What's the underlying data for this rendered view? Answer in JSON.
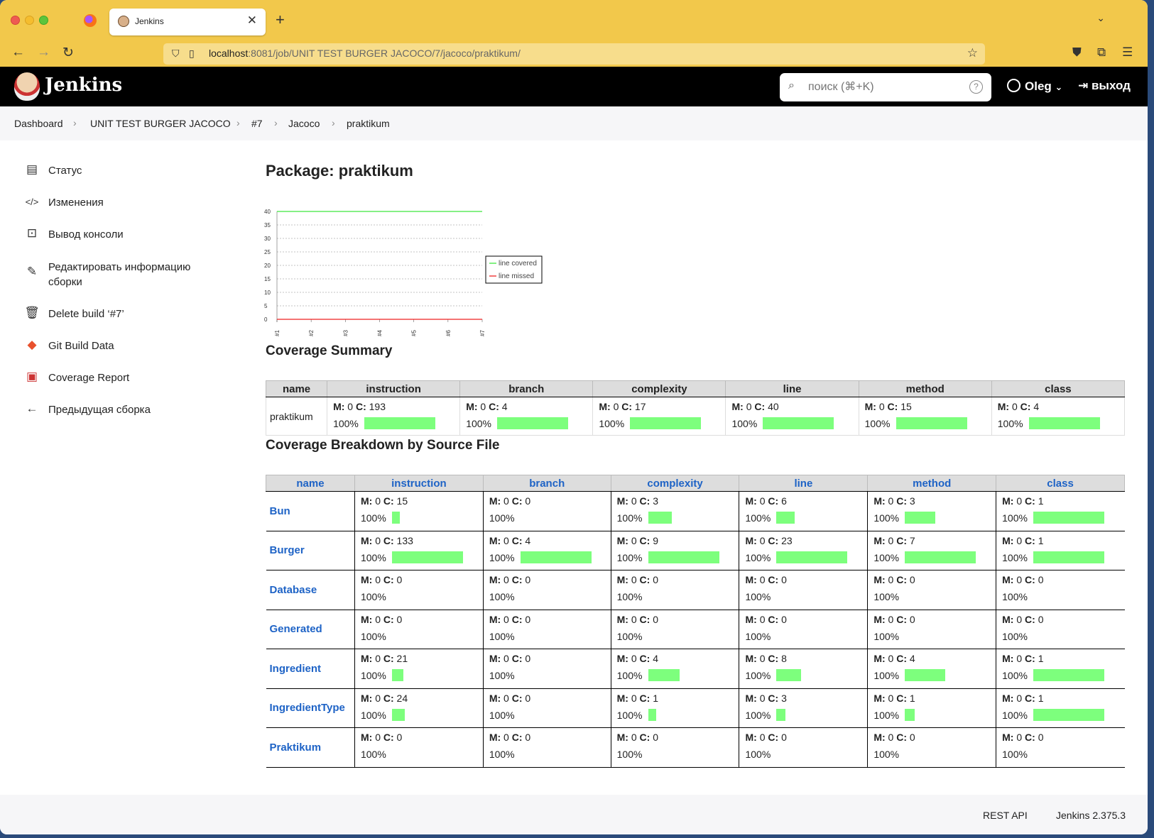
{
  "browser": {
    "tab_title": "Jenkins",
    "url_host": "localhost",
    "url_rest": ":8081/job/UNIT TEST BURGER JACOCO/7/jacoco/praktikum/"
  },
  "header": {
    "brand": "Jenkins",
    "search_placeholder": "поиск (⌘+K)",
    "help": "?",
    "user": "Oleg",
    "logout": "выход"
  },
  "breadcrumbs": [
    "Dashboard",
    "UNIT TEST BURGER JACOCO",
    "#7",
    "Jacoco",
    "praktikum"
  ],
  "sidebar": {
    "items": [
      {
        "label": "Статус",
        "icon": "document-icon"
      },
      {
        "label": "Изменения",
        "icon": "code-icon"
      },
      {
        "label": "Вывод консоли",
        "icon": "terminal-icon"
      },
      {
        "label": "Редактировать информацию сборки",
        "icon": "edit-icon"
      },
      {
        "label": "Delete build ‘#7’",
        "icon": "trash-icon"
      },
      {
        "label": "Git Build Data",
        "icon": "git-icon"
      },
      {
        "label": "Coverage Report",
        "icon": "coverage-icon"
      },
      {
        "label": "Предыдущая сборка",
        "icon": "arrow-left-icon"
      }
    ]
  },
  "main": {
    "title": "Package: praktikum",
    "summary_title": "Coverage Summary",
    "breakdown_title": "Coverage Breakdown by Source File"
  },
  "chart_data": {
    "type": "line",
    "x": [
      "#1",
      "#2",
      "#3",
      "#4",
      "#5",
      "#6",
      "#7"
    ],
    "ylim": [
      0,
      40
    ],
    "yticks": [
      0,
      5,
      10,
      15,
      20,
      25,
      30,
      35,
      40
    ],
    "series": [
      {
        "name": "line covered",
        "color": "#3ee83e",
        "values": [
          40,
          40,
          40,
          40,
          40,
          40,
          40
        ]
      },
      {
        "name": "line missed",
        "color": "#ee2222",
        "values": [
          0,
          0,
          0,
          0,
          0,
          0,
          0
        ]
      }
    ],
    "legend": "right",
    "grid": true
  },
  "columns": [
    "name",
    "instruction",
    "branch",
    "complexity",
    "line",
    "method",
    "class"
  ],
  "labels": {
    "m": "M:",
    "c": "C:"
  },
  "summary": {
    "name": "praktikum",
    "cells": [
      {
        "m": "0",
        "c": "193",
        "pct": "100%",
        "bar": 1.0
      },
      {
        "m": "0",
        "c": "4",
        "pct": "100%",
        "bar": 1.0
      },
      {
        "m": "0",
        "c": "17",
        "pct": "100%",
        "bar": 1.0
      },
      {
        "m": "0",
        "c": "40",
        "pct": "100%",
        "bar": 1.0
      },
      {
        "m": "0",
        "c": "15",
        "pct": "100%",
        "bar": 1.0
      },
      {
        "m": "0",
        "c": "4",
        "pct": "100%",
        "bar": 1.0
      }
    ]
  },
  "breakdown": [
    {
      "name": "Bun",
      "cells": [
        {
          "m": "0",
          "c": "15",
          "pct": "100%",
          "bar": 0.11
        },
        {
          "m": "0",
          "c": "0",
          "pct": "100%",
          "bar": 0
        },
        {
          "m": "0",
          "c": "3",
          "pct": "100%",
          "bar": 0.33
        },
        {
          "m": "0",
          "c": "6",
          "pct": "100%",
          "bar": 0.26
        },
        {
          "m": "0",
          "c": "3",
          "pct": "100%",
          "bar": 0.43
        },
        {
          "m": "0",
          "c": "1",
          "pct": "100%",
          "bar": 1.0
        }
      ]
    },
    {
      "name": "Burger",
      "cells": [
        {
          "m": "0",
          "c": "133",
          "pct": "100%",
          "bar": 1.0
        },
        {
          "m": "0",
          "c": "4",
          "pct": "100%",
          "bar": 1.0
        },
        {
          "m": "0",
          "c": "9",
          "pct": "100%",
          "bar": 1.0
        },
        {
          "m": "0",
          "c": "23",
          "pct": "100%",
          "bar": 1.0
        },
        {
          "m": "0",
          "c": "7",
          "pct": "100%",
          "bar": 1.0
        },
        {
          "m": "0",
          "c": "1",
          "pct": "100%",
          "bar": 1.0
        }
      ]
    },
    {
      "name": "Database",
      "cells": [
        {
          "m": "0",
          "c": "0",
          "pct": "100%",
          "bar": 0
        },
        {
          "m": "0",
          "c": "0",
          "pct": "100%",
          "bar": 0
        },
        {
          "m": "0",
          "c": "0",
          "pct": "100%",
          "bar": 0
        },
        {
          "m": "0",
          "c": "0",
          "pct": "100%",
          "bar": 0
        },
        {
          "m": "0",
          "c": "0",
          "pct": "100%",
          "bar": 0
        },
        {
          "m": "0",
          "c": "0",
          "pct": "100%",
          "bar": 0
        }
      ]
    },
    {
      "name": "Generated",
      "cells": [
        {
          "m": "0",
          "c": "0",
          "pct": "100%",
          "bar": 0
        },
        {
          "m": "0",
          "c": "0",
          "pct": "100%",
          "bar": 0
        },
        {
          "m": "0",
          "c": "0",
          "pct": "100%",
          "bar": 0
        },
        {
          "m": "0",
          "c": "0",
          "pct": "100%",
          "bar": 0
        },
        {
          "m": "0",
          "c": "0",
          "pct": "100%",
          "bar": 0
        },
        {
          "m": "0",
          "c": "0",
          "pct": "100%",
          "bar": 0
        }
      ]
    },
    {
      "name": "Ingredient",
      "cells": [
        {
          "m": "0",
          "c": "21",
          "pct": "100%",
          "bar": 0.16
        },
        {
          "m": "0",
          "c": "0",
          "pct": "100%",
          "bar": 0
        },
        {
          "m": "0",
          "c": "4",
          "pct": "100%",
          "bar": 0.44
        },
        {
          "m": "0",
          "c": "8",
          "pct": "100%",
          "bar": 0.35
        },
        {
          "m": "0",
          "c": "4",
          "pct": "100%",
          "bar": 0.57
        },
        {
          "m": "0",
          "c": "1",
          "pct": "100%",
          "bar": 1.0
        }
      ]
    },
    {
      "name": "IngredientType",
      "cells": [
        {
          "m": "0",
          "c": "24",
          "pct": "100%",
          "bar": 0.18
        },
        {
          "m": "0",
          "c": "0",
          "pct": "100%",
          "bar": 0
        },
        {
          "m": "0",
          "c": "1",
          "pct": "100%",
          "bar": 0.11
        },
        {
          "m": "0",
          "c": "3",
          "pct": "100%",
          "bar": 0.13
        },
        {
          "m": "0",
          "c": "1",
          "pct": "100%",
          "bar": 0.14
        },
        {
          "m": "0",
          "c": "1",
          "pct": "100%",
          "bar": 1.0
        }
      ]
    },
    {
      "name": "Praktikum",
      "cells": [
        {
          "m": "0",
          "c": "0",
          "pct": "100%",
          "bar": 0
        },
        {
          "m": "0",
          "c": "0",
          "pct": "100%",
          "bar": 0
        },
        {
          "m": "0",
          "c": "0",
          "pct": "100%",
          "bar": 0
        },
        {
          "m": "0",
          "c": "0",
          "pct": "100%",
          "bar": 0
        },
        {
          "m": "0",
          "c": "0",
          "pct": "100%",
          "bar": 0
        },
        {
          "m": "0",
          "c": "0",
          "pct": "100%",
          "bar": 0
        }
      ]
    }
  ],
  "footer": {
    "rest_api": "REST API",
    "version": "Jenkins 2.375.3"
  }
}
